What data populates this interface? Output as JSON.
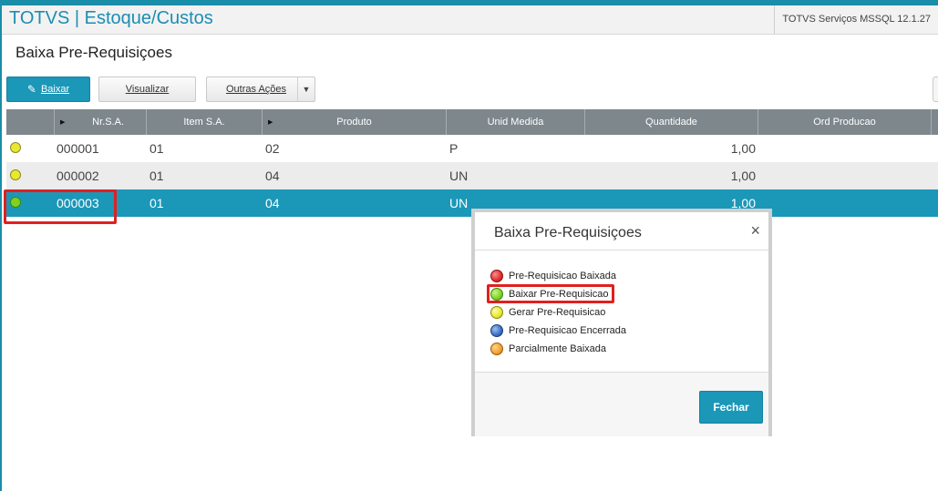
{
  "header": {
    "app_title": "TOTVS | Estoque/Custos",
    "env_info": "TOTVS Serviços MSSQL 12.1.27"
  },
  "page": {
    "title": "Baixa Pre-Requisiçoes"
  },
  "toolbar": {
    "baixar_label": "Baixar",
    "visualizar_label": "Visualizar",
    "outras_acoes_label": "Outras Ações"
  },
  "grid": {
    "columns": [
      "",
      "Nr.S.A.",
      "Item S.A.",
      "Produto",
      "Unid Medida",
      "Quantidade",
      "Ord Producao"
    ],
    "rows": [
      {
        "status": "yellow",
        "nr": "000001",
        "item": "01",
        "produto": "02",
        "unid": "P",
        "qtd": "1,00"
      },
      {
        "status": "yellow",
        "nr": "000002",
        "item": "01",
        "produto": "04",
        "unid": "UN",
        "qtd": "1,00"
      },
      {
        "status": "green",
        "nr": "000003",
        "item": "01",
        "produto": "04",
        "unid": "UN",
        "qtd": "1,00"
      }
    ]
  },
  "modal": {
    "title": "Baixa Pre-Requisiçoes",
    "close_symbol": "×",
    "legend": [
      {
        "color": "red",
        "label": "Pre-Requisicao Baixada"
      },
      {
        "color": "green",
        "label": "Baixar Pre-Requisicao"
      },
      {
        "color": "yellow",
        "label": "Gerar Pre-Requisicao"
      },
      {
        "color": "blue",
        "label": "Pre-Requisicao Encerrada"
      },
      {
        "color": "orange",
        "label": "Parcialmente Baixada"
      }
    ],
    "close_button_label": "Fechar"
  },
  "colors": {
    "accent": "#1b97b8",
    "yellow": "#e8e830",
    "green": "#7ed321",
    "red": "#d93030",
    "blue": "#3a6fc4",
    "orange": "#f0a030",
    "highlight": "#e02020"
  },
  "icons": {
    "pencil": "pencil-icon",
    "dropdown": "caret-down-icon",
    "sort": "sort-arrow-icon",
    "close": "close-icon"
  }
}
